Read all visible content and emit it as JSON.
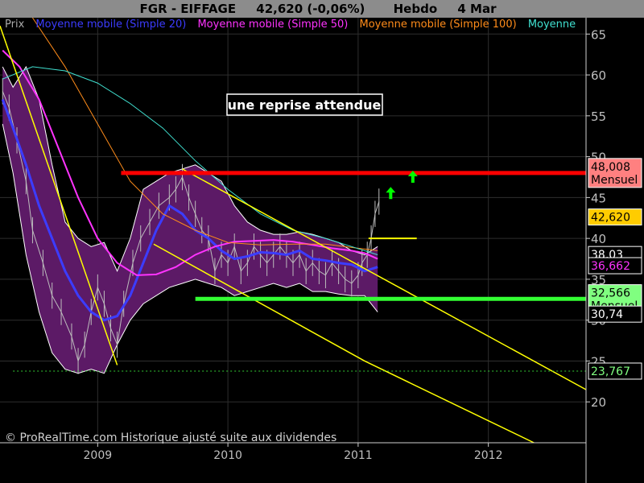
{
  "header": {
    "symbol": "FGR - EIFFAGE",
    "price_change": "42,620 (-0,06%)",
    "period": "Hebdo",
    "date": "4 Mar"
  },
  "legend": [
    {
      "label": "Prix",
      "color": "#aaaaaa"
    },
    {
      "label": "Moyenne mobile (Simple 20)",
      "color": "#3c3cff"
    },
    {
      "label": "Moyenne mobile (Simple 50)",
      "color": "#ff33ff"
    },
    {
      "label": "Moyenne mobile (Simple 100)",
      "color": "#ff8c1a"
    },
    {
      "label": "Moyenne",
      "color": "#40e0d0"
    }
  ],
  "annotation": "une reprise attendue",
  "watermark": "© ProRealTime.com Historique ajusté suite aux dividendes",
  "chart_data": {
    "type": "line",
    "y_axis": {
      "ylim": [
        15,
        67
      ],
      "ticks": [
        20,
        25,
        30,
        35,
        40,
        45,
        50,
        55,
        60,
        65
      ],
      "position": "right"
    },
    "x_axis": {
      "xlim": [
        2008.25,
        2012.75
      ],
      "ticks": [
        "2009",
        "2010",
        "2011",
        "2012"
      ],
      "tick_values": [
        2009,
        2010,
        2011,
        2012
      ]
    },
    "price_labels": [
      {
        "text": "48,008",
        "sub": "Mensuel",
        "value": 48.008,
        "bg": "#ff8080",
        "fg": "#000000"
      },
      {
        "text": "42,620",
        "value": 42.62,
        "bg": "#ffcc00",
        "fg": "#000000"
      },
      {
        "text": "38,03",
        "value": 38.03,
        "bg": "#000000",
        "fg": "#ffffff"
      },
      {
        "text": "36,662",
        "value": 36.662,
        "bg": "#000000",
        "fg": "#ff33ff"
      },
      {
        "text": "32,566",
        "sub": "Mensuel",
        "value": 32.566,
        "bg": "#80ff80",
        "fg": "#000000"
      },
      {
        "text": "30,74",
        "value": 30.74,
        "bg": "#000000",
        "fg": "#ffffff"
      },
      {
        "text": "23,767",
        "value": 23.767,
        "bg": "#000000",
        "fg": "#80ff80"
      }
    ],
    "horizontal_lines": [
      {
        "name": "resistance",
        "y": 48.0,
        "x_from": 2009.18,
        "x_to": 2012.75,
        "color": "#ff0000",
        "width": 5
      },
      {
        "name": "support",
        "y": 32.6,
        "x_from": 2009.75,
        "x_to": 2012.75,
        "color": "#33ff33",
        "width": 5
      },
      {
        "name": "low",
        "y": 23.77,
        "x_from": 2008.35,
        "x_to": 2012.75,
        "color": "#33cc33",
        "width": 1,
        "dash": true
      },
      {
        "name": "current",
        "y": 40.0,
        "x_from": 2011.08,
        "x_to": 2011.45,
        "color": "#ffff00",
        "width": 2
      }
    ],
    "trend_lines": [
      {
        "name": "trend-steep",
        "points": [
          [
            2008.25,
            66
          ],
          [
            2009.15,
            24.5
          ]
        ],
        "color": "#ffff00"
      },
      {
        "name": "channel-upper",
        "points": [
          [
            2009.65,
            48.5
          ],
          [
            2012.75,
            21.5
          ]
        ],
        "color": "#ffff00"
      },
      {
        "name": "channel-lower",
        "points": [
          [
            2009.43,
            39.3
          ],
          [
            2011.05,
            25
          ],
          [
            2012.35,
            15
          ]
        ],
        "color": "#ffff00"
      }
    ],
    "arrows": [
      {
        "x": 2011.25,
        "y": 45.5,
        "color": "#00ff00"
      },
      {
        "x": 2011.42,
        "y": 47.5,
        "color": "#00ff00"
      }
    ],
    "series": [
      {
        "name": "Moyenne mobile (Simple 20)",
        "color": "#3c3cff",
        "width": 3,
        "x": [
          2008.27,
          2008.35,
          2008.45,
          2008.55,
          2008.65,
          2008.75,
          2008.85,
          2008.95,
          2009.05,
          2009.15,
          2009.25,
          2009.35,
          2009.45,
          2009.55,
          2009.65,
          2009.75,
          2009.85,
          2009.95,
          2010.05,
          2010.15,
          2010.25,
          2010.35,
          2010.45,
          2010.55,
          2010.65,
          2010.75,
          2010.85,
          2010.95,
          2011.05,
          2011.15
        ],
        "y": [
          57,
          53.5,
          49,
          44,
          40,
          36,
          33,
          31,
          30,
          30.5,
          33,
          37,
          41,
          44,
          43,
          41,
          40,
          38.5,
          37.5,
          37.8,
          38.3,
          38.2,
          38,
          38.5,
          37.5,
          37.3,
          37,
          36.8,
          36,
          36.5
        ]
      },
      {
        "name": "Moyenne mobile (Simple 50)",
        "color": "#ff33ff",
        "width": 2,
        "x": [
          2008.27,
          2008.4,
          2008.55,
          2008.7,
          2008.85,
          2009.0,
          2009.15,
          2009.3,
          2009.45,
          2009.6,
          2009.75,
          2009.9,
          2010.05,
          2010.2,
          2010.35,
          2010.5,
          2010.65,
          2010.8,
          2010.95,
          2011.05,
          2011.15
        ],
        "y": [
          63,
          61,
          57,
          51,
          45,
          40,
          37,
          35.5,
          35.6,
          36.5,
          38,
          39,
          39.6,
          39.7,
          39.8,
          39.6,
          39.2,
          38.8,
          38.5,
          38.2,
          37.5
        ]
      },
      {
        "name": "Moyenne mobile (Simple 100)",
        "color": "#ff8c1a",
        "width": 1,
        "x": [
          2008.27,
          2008.5,
          2008.75,
          2009.0,
          2009.25,
          2009.5,
          2009.75,
          2010.0,
          2010.25,
          2010.5,
          2010.75,
          2011.0,
          2011.15
        ],
        "y": [
          72,
          67,
          61,
          54,
          47,
          43,
          41,
          39.5,
          39.2,
          39.3,
          39.3,
          38.8,
          38.5
        ]
      },
      {
        "name": "Moyenne",
        "color": "#40e0d0",
        "width": 1,
        "x": [
          2008.27,
          2008.5,
          2008.75,
          2009.0,
          2009.25,
          2009.5,
          2009.75,
          2010.0,
          2010.25,
          2010.5,
          2010.75,
          2010.95,
          2011.15
        ],
        "y": [
          59.5,
          61,
          60.5,
          59,
          56.5,
          53.5,
          49.5,
          46,
          43,
          41,
          40,
          39,
          38
        ]
      }
    ],
    "bollinger": {
      "color": "#5c1a66",
      "edge": "#ffffff",
      "x": [
        2008.27,
        2008.35,
        2008.45,
        2008.55,
        2008.65,
        2008.75,
        2008.85,
        2008.95,
        2009.05,
        2009.15,
        2009.25,
        2009.35,
        2009.45,
        2009.55,
        2009.65,
        2009.75,
        2009.85,
        2009.95,
        2010.05,
        2010.15,
        2010.25,
        2010.35,
        2010.45,
        2010.55,
        2010.65,
        2010.75,
        2010.85,
        2010.95,
        2011.05,
        2011.15
      ],
      "upper": [
        61,
        58.5,
        61,
        57,
        49,
        42,
        40,
        39,
        39.5,
        36,
        40,
        46,
        47,
        48,
        48.5,
        49,
        48,
        47,
        44,
        42,
        41,
        40.5,
        40.5,
        40.8,
        40.5,
        40,
        39.5,
        38.5,
        38,
        39
      ],
      "lower": [
        54,
        48,
        38,
        31,
        26,
        24,
        23.5,
        24,
        23.5,
        27,
        30,
        32,
        33,
        34,
        34.5,
        35,
        34.5,
        34,
        33,
        33.5,
        34,
        34.5,
        34,
        34.5,
        33.5,
        33.5,
        33.2,
        33,
        33,
        31
      ]
    },
    "price": {
      "color": "#bdbdbd",
      "x": [
        2008.27,
        2008.32,
        2008.38,
        2008.45,
        2008.5,
        2008.58,
        2008.65,
        2008.72,
        2008.8,
        2008.85,
        2008.9,
        2008.95,
        2009.0,
        2009.05,
        2009.1,
        2009.15,
        2009.2,
        2009.27,
        2009.33,
        2009.4,
        2009.47,
        2009.55,
        2009.6,
        2009.65,
        2009.7,
        2009.75,
        2009.8,
        2009.85,
        2009.9,
        2009.95,
        2010.0,
        2010.05,
        2010.1,
        2010.15,
        2010.2,
        2010.25,
        2010.3,
        2010.35,
        2010.4,
        2010.45,
        2010.5,
        2010.55,
        2010.6,
        2010.65,
        2010.7,
        2010.75,
        2010.8,
        2010.85,
        2010.9,
        2010.95,
        2011.0,
        2011.03,
        2011.07,
        2011.1,
        2011.13,
        2011.16
      ],
      "y": [
        58,
        56,
        52,
        47,
        41,
        37,
        33,
        31,
        28,
        25,
        27,
        31,
        34,
        32,
        29,
        27,
        32,
        37,
        40,
        42,
        44,
        45,
        46,
        47.5,
        45,
        43,
        41,
        40,
        36,
        38,
        37,
        39,
        36,
        37,
        39,
        38,
        37,
        38,
        39,
        38,
        37,
        38,
        36,
        37,
        36,
        35.5,
        37,
        36,
        35,
        34.5,
        35.5,
        37,
        38,
        40,
        43,
        44.5
      ]
    }
  }
}
